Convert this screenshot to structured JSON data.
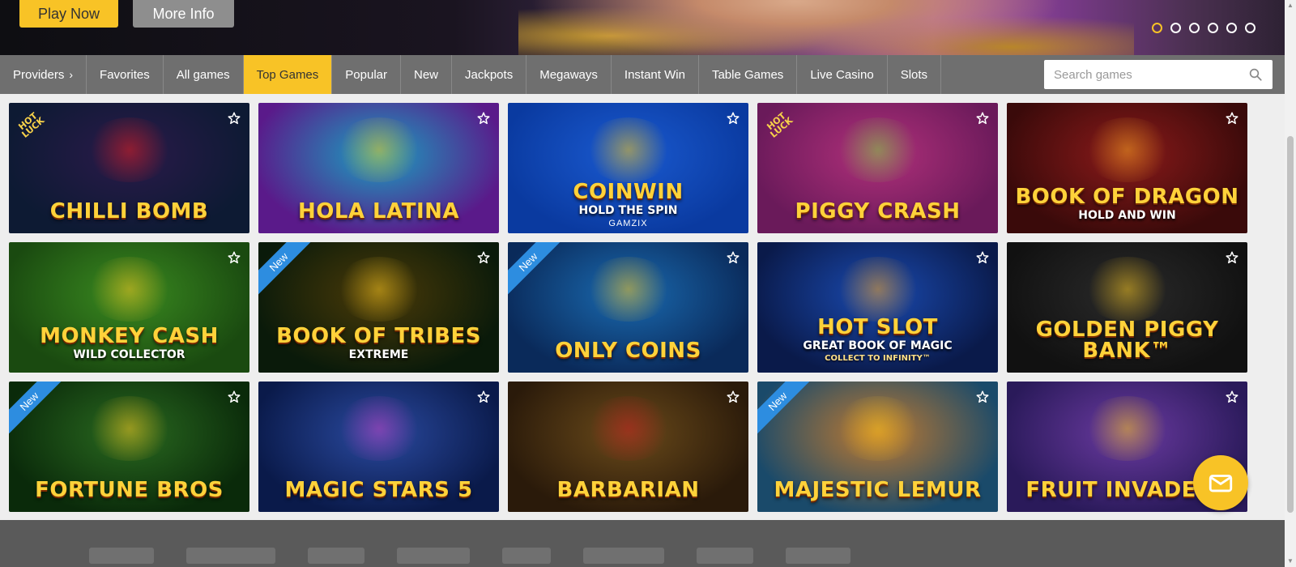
{
  "hero": {
    "play_label": "Play Now",
    "info_label": "More Info",
    "slide_count": 6,
    "active_slide": 1
  },
  "nav": {
    "items": [
      {
        "label": "Providers",
        "has_chevron": true
      },
      {
        "label": "Favorites"
      },
      {
        "label": "All games"
      },
      {
        "label": "Top Games",
        "active": true
      },
      {
        "label": "Popular"
      },
      {
        "label": "New"
      },
      {
        "label": "Jackpots"
      },
      {
        "label": "Megaways"
      },
      {
        "label": "Instant Win"
      },
      {
        "label": "Table Games"
      },
      {
        "label": "Live Casino"
      },
      {
        "label": "Slots"
      }
    ],
    "search_placeholder": "Search games"
  },
  "games": [
    {
      "title": "CHILLI BOMB",
      "badge": "HOT LUCK",
      "bg1": "#0d1a33",
      "bg2": "#2a1a4a",
      "accent": "#e02020"
    },
    {
      "title": "HOLA Latina",
      "badge": "",
      "bg1": "#5a1a8a",
      "bg2": "#1aa0c0",
      "accent": "#f0c020"
    },
    {
      "title": "COINWIN",
      "subtitle": "HOLD THE SPIN",
      "brand": "GAMZIX",
      "badge": "",
      "bg1": "#0a3aa0",
      "bg2": "#1a5ad0",
      "accent": "#f5c518"
    },
    {
      "title": "PIGGY CRASH",
      "badge": "HOT LUCK",
      "bg1": "#6a1a5a",
      "bg2": "#b0307a",
      "accent": "#7ad040"
    },
    {
      "title": "BOOK of DRAGON",
      "subtitle": "HOLD AND WIN",
      "badge": "",
      "bg1": "#3a0a0a",
      "bg2": "#8a1a1a",
      "accent": "#f0a020"
    },
    {
      "title": "MONKEY CASH",
      "subtitle": "WILD COLLECTOR",
      "badge": "",
      "bg1": "#1a4a10",
      "bg2": "#3a8a20",
      "accent": "#f0c020"
    },
    {
      "title": "BOOK OF TRIBES",
      "subtitle": "EXTREME",
      "badge": "New",
      "bg1": "#0a1a0a",
      "bg2": "#4a3a08",
      "accent": "#f0c020"
    },
    {
      "title": "Only COINS",
      "badge": "New",
      "bg1": "#0a2a5a",
      "bg2": "#1a6ab0",
      "accent": "#f0c020"
    },
    {
      "title": "HOT SLOT",
      "subtitle": "GREAT BOOK OF MAGIC",
      "tagline": "COLLECT TO INFINITY™",
      "badge": "",
      "bg1": "#0a1a4a",
      "bg2": "#1a4ab0",
      "accent": "#f0a020"
    },
    {
      "title": "GOLDEN PIGGY BANK™",
      "badge": "",
      "bg1": "#111111",
      "bg2": "#2a2a2a",
      "accent": "#f0c020"
    },
    {
      "title": "FORTUNE BROS",
      "badge": "New",
      "bg1": "#0a2a0a",
      "bg2": "#2a6a20",
      "accent": "#f0c020"
    },
    {
      "title": "Magic Stars 5",
      "badge": "",
      "bg1": "#0a1a4a",
      "bg2": "#2a4aa0",
      "accent": "#c040c0"
    },
    {
      "title": "BARBARIAN",
      "badge": "",
      "bg1": "#2a1a0a",
      "bg2": "#6a4a1a",
      "accent": "#c02020"
    },
    {
      "title": "MAJESTIC LEMUR",
      "badge": "New",
      "bg1": "#1a4a6a",
      "bg2": "#c07a30",
      "accent": "#f0c020"
    },
    {
      "title": "FRUIT INVADERS",
      "badge": "",
      "bg1": "#2a1a5a",
      "bg2": "#6a3aa0",
      "accent": "#f0c020"
    }
  ],
  "colors": {
    "accent": "#f8c326",
    "nav_bg": "#6f6f6f",
    "footer_bg": "#5a5a5a",
    "new_ribbon": "#2d8de0"
  },
  "chat": {
    "icon": "mail-icon"
  }
}
